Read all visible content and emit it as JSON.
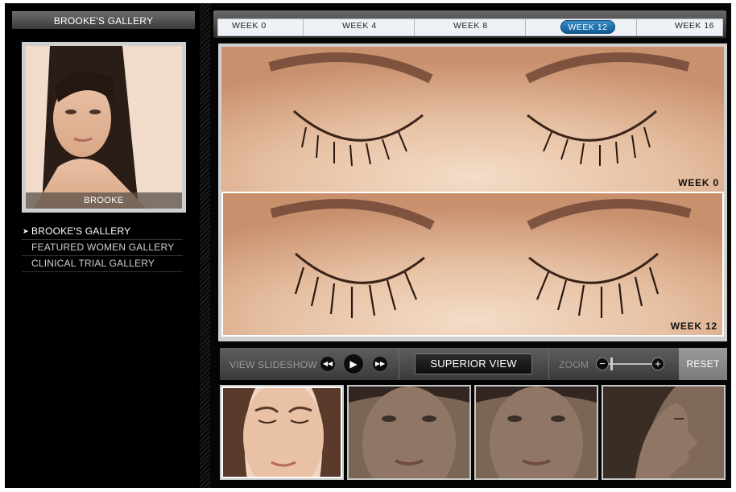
{
  "sidebar": {
    "header": "BROOKE'S GALLERY",
    "portrait_caption": "BROOKE",
    "nav": [
      {
        "label": "BROOKE'S GALLERY",
        "active": true
      },
      {
        "label": "FEATURED WOMEN GALLERY",
        "active": false
      },
      {
        "label": "CLINICAL TRIAL GALLERY",
        "active": false
      }
    ]
  },
  "timeline": {
    "weeks": [
      "WEEK 0",
      "WEEK 4",
      "WEEK 8",
      "WEEK 12",
      "WEEK 16"
    ],
    "selected": "WEEK 12"
  },
  "viewer": {
    "top_label": "WEEK 0",
    "bottom_label": "WEEK 12"
  },
  "controls": {
    "slideshow_label": "VIEW SLIDESHOW",
    "superior_view_label": "SUPERIOR VIEW",
    "zoom_label": "ZOOM",
    "reset_label": "RESET",
    "zoom_level": 0
  },
  "thumbnails": [
    {
      "view": "superior",
      "selected": true
    },
    {
      "view": "front",
      "selected": false
    },
    {
      "view": "front",
      "selected": false
    },
    {
      "view": "profile",
      "selected": false
    }
  ]
}
